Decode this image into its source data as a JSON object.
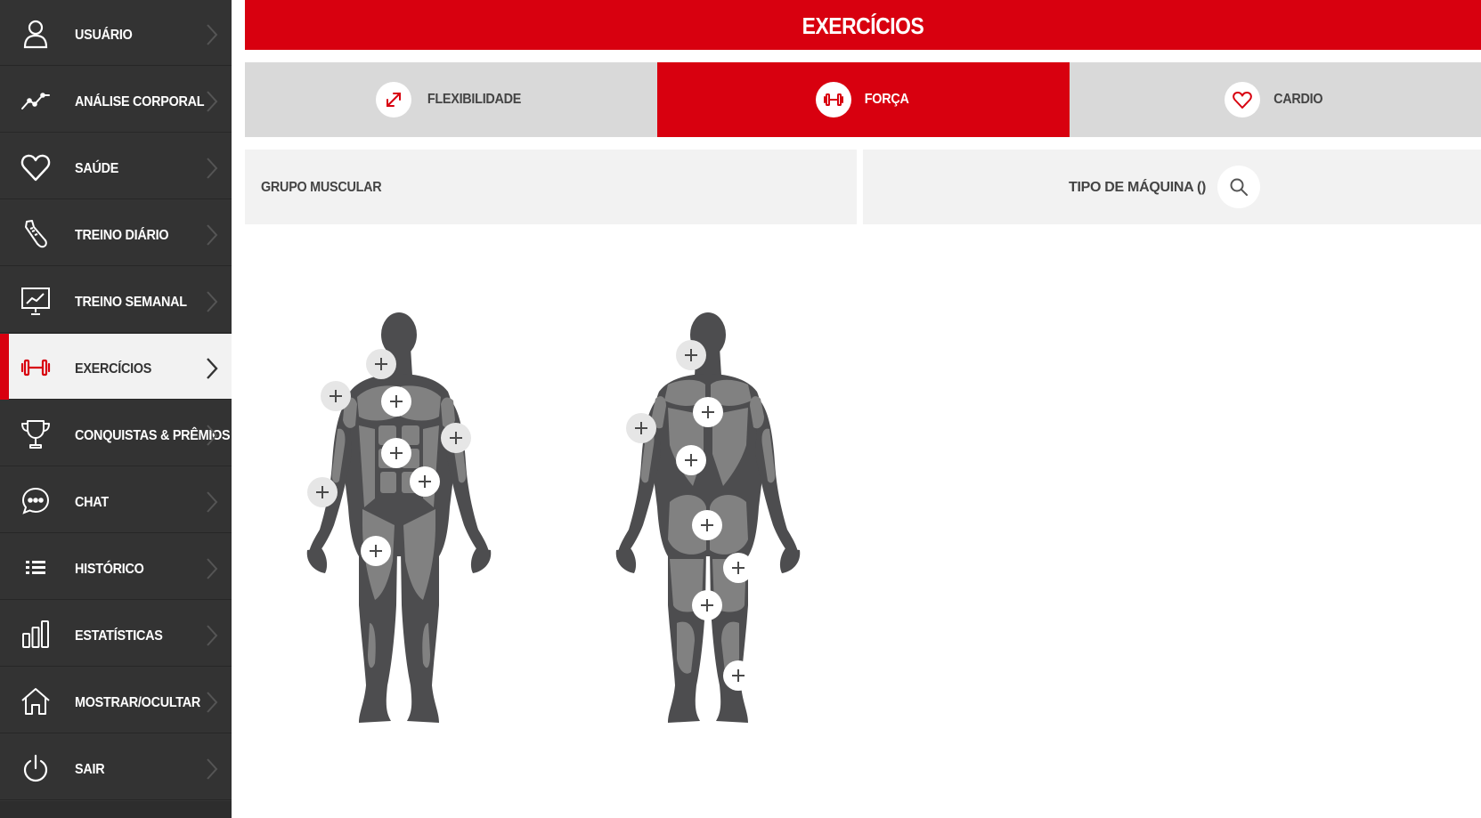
{
  "header": {
    "title": "EXERCÍCIOS"
  },
  "sidebar": {
    "items": [
      {
        "label": "USUÁRIO",
        "icon": "user-icon"
      },
      {
        "label": "ANÁLISE CORPORAL",
        "icon": "trend-line-icon"
      },
      {
        "label": "SAÚDE",
        "icon": "heart-icon"
      },
      {
        "label": "TREINO DIÁRIO",
        "icon": "sneaker-icon"
      },
      {
        "label": "TREINO SEMANAL",
        "icon": "presentation-board-icon"
      },
      {
        "label": "EXERCÍCIOS",
        "icon": "dumbbell-icon",
        "active": true
      },
      {
        "label": "CONQUISTAS & PRÊMIOS",
        "icon": "trophy-icon"
      },
      {
        "label": "CHAT",
        "icon": "chat-bubble-icon"
      },
      {
        "label": "HISTÓRICO",
        "icon": "list-icon"
      },
      {
        "label": "ESTATÍSTICAS",
        "icon": "bar-chart-icon"
      },
      {
        "label": "MOSTRAR/OCULTAR",
        "icon": "home-icon"
      },
      {
        "label": "SAIR",
        "icon": "power-icon"
      }
    ]
  },
  "tabs": [
    {
      "label": "FLEXIBILIDADE",
      "icon": "expand-arrows-icon",
      "active": false
    },
    {
      "label": "FORÇA",
      "icon": "dumbbell-icon",
      "active": true
    },
    {
      "label": "CARDIO",
      "icon": "heart-icon",
      "active": false
    }
  ],
  "filters": {
    "muscle_group_label": "GRUPO MUSCULAR",
    "machine_type_label": "TIPO DE MÁQUINA ()",
    "search_icon": "search-icon"
  },
  "colors": {
    "accent": "#d8000f",
    "sidebar_bg": "#333333",
    "tab_bg": "#d9d9d9",
    "filter_bg": "#f2f2f2",
    "body_dark": "#4d4d4f",
    "muscle_light": "#818181"
  }
}
